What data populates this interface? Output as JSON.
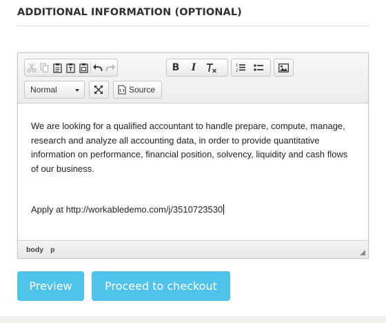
{
  "section": {
    "title": "ADDITIONAL INFORMATION (OPTIONAL)"
  },
  "toolbar": {
    "row1": [
      {
        "icon": "cut-icon",
        "state": "disabled"
      },
      {
        "icon": "copy-icon",
        "state": "disabled"
      },
      {
        "icon": "paste-icon",
        "state": "enabled"
      },
      {
        "icon": "paste-text-icon",
        "state": "enabled"
      },
      {
        "icon": "paste-from-word-icon",
        "state": "enabled"
      },
      {
        "icon": "undo-icon",
        "state": "enabled"
      },
      {
        "icon": "redo-icon",
        "state": "disabled"
      },
      {
        "icon": "bold-icon",
        "label": "B"
      },
      {
        "icon": "italic-icon",
        "label": "I"
      },
      {
        "icon": "remove-format-icon",
        "label": "Ix"
      },
      {
        "icon": "numbered-list-icon"
      },
      {
        "icon": "bulleted-list-icon"
      },
      {
        "icon": "image-icon"
      }
    ],
    "format_combo": {
      "value": "Normal"
    },
    "maximize": {
      "icon": "maximize-icon"
    },
    "source": {
      "icon": "source-icon",
      "label": "Source"
    }
  },
  "content": {
    "paragraph": "We are looking for a qualified accountant to handle prepare, compute, manage, research and analyze all accounting data, in order to provide quantitative information on performance, financial position, solvency, liquidity and cash flows of our business.",
    "apply_line": "Apply at http://workabledemo.com/j/3510723530"
  },
  "statusbar": {
    "path": [
      "body",
      "p"
    ]
  },
  "buttons": {
    "preview": "Preview",
    "checkout": "Proceed to checkout"
  },
  "colors": {
    "button_bg": "#4fc3ea",
    "divider": "#e4e1cf",
    "footer_band": "#f3f2ea"
  }
}
